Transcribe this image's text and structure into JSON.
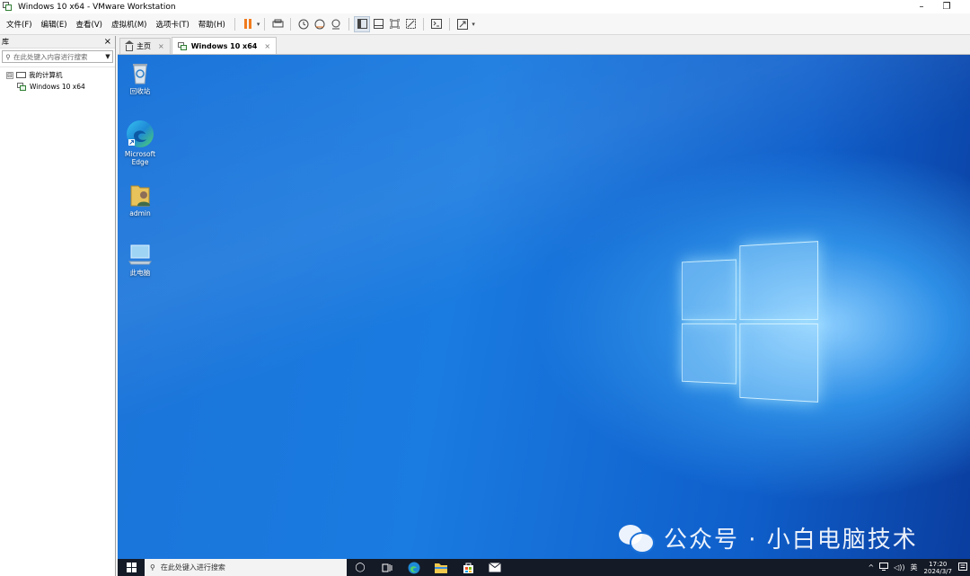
{
  "window": {
    "title": "Windows 10 x64 - VMware Workstation"
  },
  "menu": [
    {
      "label": "文件(F)"
    },
    {
      "label": "编辑(E)"
    },
    {
      "label": "查看(V)"
    },
    {
      "label": "虚拟机(M)"
    },
    {
      "label": "选项卡(T)"
    },
    {
      "label": "帮助(H)"
    }
  ],
  "library": {
    "title": "库",
    "close": "×",
    "search_placeholder": "在此处键入内容进行搜索",
    "tree": [
      {
        "label": "我的计算机",
        "expander": "⊟"
      },
      {
        "label": "Windows 10 x64"
      }
    ]
  },
  "tabs": [
    {
      "label": "主页",
      "close": "×"
    },
    {
      "label": "Windows 10 x64",
      "close": "×"
    }
  ],
  "desktop": {
    "icons": [
      {
        "label": "回收站",
        "icon": "recycle-bin-icon"
      },
      {
        "label": "Microsoft Edge",
        "icon": "edge-icon"
      },
      {
        "label": "admin",
        "icon": "user-folder-icon"
      },
      {
        "label": "此电脑",
        "icon": "this-pc-icon"
      }
    ]
  },
  "taskbar": {
    "search_placeholder": "在此处键入进行搜索",
    "lang": "英",
    "time": "17:20",
    "date": "2024/3/7",
    "tray_chevron": "^",
    "volume_glyph": "◁))",
    "taskview_glyph": "◯"
  },
  "watermark": {
    "text": "公众号 · 小白电脑技术"
  },
  "colors": {
    "taskbar": "#141a26",
    "desktop_blue": "#1a7be0",
    "pause_orange": "#f07b1d"
  }
}
